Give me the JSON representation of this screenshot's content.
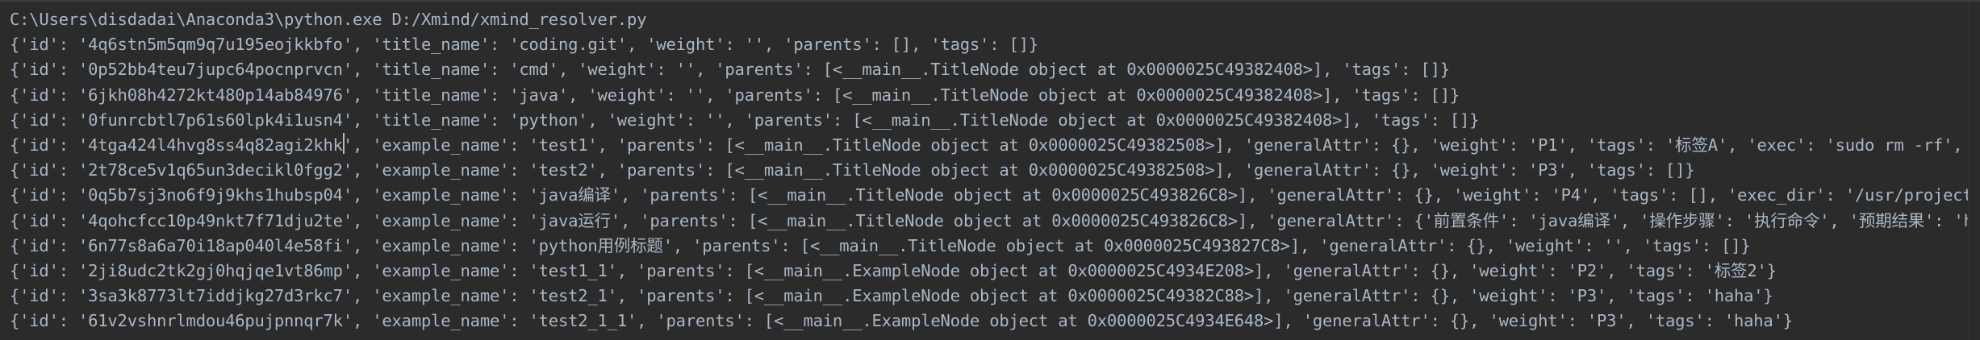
{
  "console": {
    "command": "C:\\Users\\disdadai\\Anaconda3\\python.exe D:/Xmind/xmind_resolver.py",
    "output": [
      "{'id': '4q6stn5m5qm9q7u195eojkkbfo', 'title_name': 'coding.git', 'weight': '', 'parents': [], 'tags': []}",
      "{'id': '0p52bb4teu7jupc64pocnprvcn', 'title_name': 'cmd', 'weight': '', 'parents': [<__main__.TitleNode object at 0x0000025C49382408>], 'tags': []}",
      "{'id': '6jkh08h4272kt480p14ab84976', 'title_name': 'java', 'weight': '', 'parents': [<__main__.TitleNode object at 0x0000025C49382408>], 'tags': []}",
      "{'id': '0funrcbtl7p61s60lpk4i1usn4', 'title_name': 'python', 'weight': '', 'parents': [<__main__.TitleNode object at 0x0000025C49382408>], 'tags': []}",
      "{'id': '4tga424l4hvg8ss4q82agi2khk', 'example_name': 'test1', 'parents': [<__main__.TitleNode object at 0x0000025C49382508>], 'generalAttr': {}, 'weight': 'P1', 'tags': '标签A', 'exec': 'sudo rm -rf', '",
      "{'id': '2t78ce5v1q65un3decikl0fgg2', 'example_name': 'test2', 'parents': [<__main__.TitleNode object at 0x0000025C49382508>], 'generalAttr': {}, 'weight': 'P3', 'tags': []}",
      "{'id': '0q5b7sj3no6f9j9khs1hubsp04', 'example_name': 'java编译', 'parents': [<__main__.TitleNode object at 0x0000025C493826C8>], 'generalAttr': {}, 'weight': 'P4', 'tags': [], 'exec_dir': '/usr/project'",
      "{'id': '4qohcfcc10p49nkt7f71dju2te', 'example_name': 'java运行', 'parents': [<__main__.TitleNode object at 0x0000025C493826C8>], 'generalAttr': {'前置条件': 'java编译', '操作步骤': '执行命令', '预期结果': 'he",
      "{'id': '6n77s8a6a70i18ap040l4e58fi', 'example_name': 'python用例标题', 'parents': [<__main__.TitleNode object at 0x0000025C493827C8>], 'generalAttr': {}, 'weight': '', 'tags': []}",
      "{'id': '2ji8udc2tk2gj0hqjqe1vt86mp', 'example_name': 'test1_1', 'parents': [<__main__.ExampleNode object at 0x0000025C4934E208>], 'generalAttr': {}, 'weight': 'P2', 'tags': '标签2'}",
      "{'id': '3sa3k8773lt7iddjkg27d3rkc7', 'example_name': 'test2_1', 'parents': [<__main__.ExampleNode object at 0x0000025C49382C88>], 'generalAttr': {}, 'weight': 'P3', 'tags': 'haha'}",
      "{'id': '61v2vshnrlmdou46pujpnnqr7k', 'example_name': 'test2_1_1', 'parents': [<__main__.ExampleNode object at 0x0000025C4934E648>], 'generalAttr': {}, 'weight': 'P3', 'tags': 'haha'}"
    ]
  }
}
